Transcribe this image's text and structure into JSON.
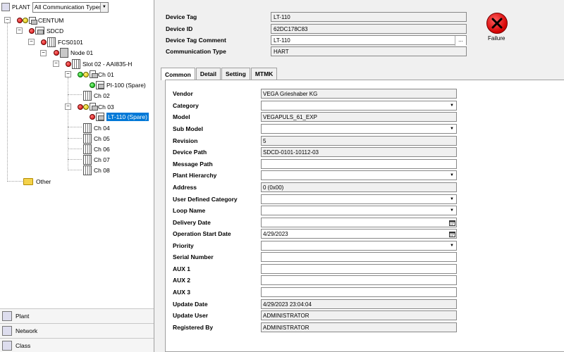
{
  "left": {
    "top_label": "PLANT",
    "filter": {
      "selected": "All Communication Types"
    },
    "tree": [
      {
        "label": "CENTUM"
      },
      {
        "label": "SDCD"
      },
      {
        "label": "FCS0101"
      },
      {
        "label": "Node 01"
      },
      {
        "label": "Slot 02 - AAI835-H"
      },
      {
        "label": "Ch 01"
      },
      {
        "label": "PI-100 (Spare)"
      },
      {
        "label": "Ch 02"
      },
      {
        "label": "Ch 03"
      },
      {
        "label": "LT-110 (Spare)"
      },
      {
        "label": "Ch 04"
      },
      {
        "label": "Ch 05"
      },
      {
        "label": "Ch 06"
      },
      {
        "label": "Ch 07"
      },
      {
        "label": "Ch 08"
      },
      {
        "label": "Other"
      }
    ],
    "nav": [
      {
        "label": "Plant"
      },
      {
        "label": "Network"
      },
      {
        "label": "Class"
      }
    ]
  },
  "header": {
    "device_tag": {
      "label": "Device Tag",
      "value": "LT-110"
    },
    "device_id": {
      "label": "Device ID",
      "value": "62DC178C83"
    },
    "device_tag_comment": {
      "label": "Device Tag Comment",
      "value": "LT-110",
      "button": "..."
    },
    "comm_type": {
      "label": "Communication Type",
      "value": "HART"
    },
    "status": "Failure"
  },
  "tabs": [
    {
      "label": "Common"
    },
    {
      "label": "Detail"
    },
    {
      "label": "Setting"
    },
    {
      "label": "MTMK"
    }
  ],
  "fields": [
    {
      "label": "Vendor",
      "value": "VEGA Grieshaber KG"
    },
    {
      "label": "Category",
      "value": ""
    },
    {
      "label": "Model",
      "value": "VEGAPULS_61_EXP"
    },
    {
      "label": "Sub Model",
      "value": ""
    },
    {
      "label": "Revision",
      "value": "5"
    },
    {
      "label": "Device Path",
      "value": "SDCD-0101-10112-03"
    },
    {
      "label": "Message Path",
      "value": ""
    },
    {
      "label": "Plant Hierarchy",
      "value": ""
    },
    {
      "label": "Address",
      "value": "0 (0x00)"
    },
    {
      "label": "User Defined Category",
      "value": ""
    },
    {
      "label": "Loop Name",
      "value": ""
    },
    {
      "label": "Delivery Date",
      "value": ""
    },
    {
      "label": "Operation Start Date",
      "value": "4/29/2023"
    },
    {
      "label": "Priority",
      "value": ""
    },
    {
      "label": "Serial Number",
      "value": ""
    },
    {
      "label": "AUX 1",
      "value": ""
    },
    {
      "label": "AUX 2",
      "value": ""
    },
    {
      "label": "AUX 3",
      "value": ""
    },
    {
      "label": "Update Date",
      "value": "4/29/2023 23:04:04"
    },
    {
      "label": "Update User",
      "value": "ADMINISTRATOR"
    },
    {
      "label": "Registered By",
      "value": "ADMINISTRATOR"
    }
  ]
}
